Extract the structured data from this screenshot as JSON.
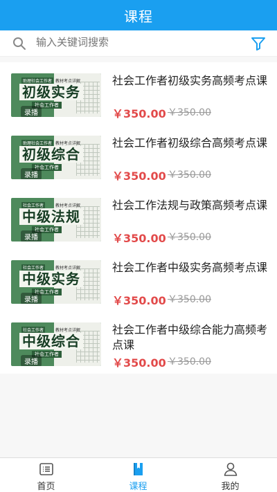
{
  "header": {
    "title": "课程"
  },
  "search": {
    "placeholder": "输入关键词搜索"
  },
  "courses": [
    {
      "name": "社会工作者初级实务高频考点课",
      "price": "￥350.00",
      "original_price": "￥350.00",
      "cover_title": "初级实务",
      "cover_tag": "助理社会工作者",
      "cover_tag2": "教材考点详解",
      "cover_sub": "社会工作者",
      "badge": "录播"
    },
    {
      "name": "社会工作者初级综合高频考点课",
      "price": "￥350.00",
      "original_price": "￥350.00",
      "cover_title": "初级综合",
      "cover_tag": "助理社会工作者",
      "cover_tag2": "教材考点详解",
      "cover_sub": "社会工作者",
      "badge": "录播"
    },
    {
      "name": "社会工作法规与政策高频考点课",
      "price": "￥350.00",
      "original_price": "￥350.00",
      "cover_title": "中级法规",
      "cover_tag": "社会工作者",
      "cover_tag2": "教材考点详解",
      "cover_sub": "社会工作者",
      "badge": "录播"
    },
    {
      "name": "社会工作者中级实务高频考点课",
      "price": "￥350.00",
      "original_price": "￥350.00",
      "cover_title": "中级实务",
      "cover_tag": "社会工作者",
      "cover_tag2": "教材考点详解",
      "cover_sub": "社会工作者",
      "badge": "录播"
    },
    {
      "name": "社会工作者中级综合能力高频考点课",
      "price": "￥350.00",
      "original_price": "￥350.00",
      "cover_title": "中级综合",
      "cover_tag": "社会工作者",
      "cover_tag2": "教材考点详解",
      "cover_sub": "社会工作者",
      "badge": "录播"
    }
  ],
  "tabbar": {
    "items": [
      {
        "label": "首页",
        "icon": "list-icon"
      },
      {
        "label": "课程",
        "icon": "book-icon",
        "active": true
      },
      {
        "label": "我的",
        "icon": "user-icon"
      }
    ]
  },
  "colors": {
    "accent": "#1a9ff0",
    "price": "#e24a4a"
  }
}
